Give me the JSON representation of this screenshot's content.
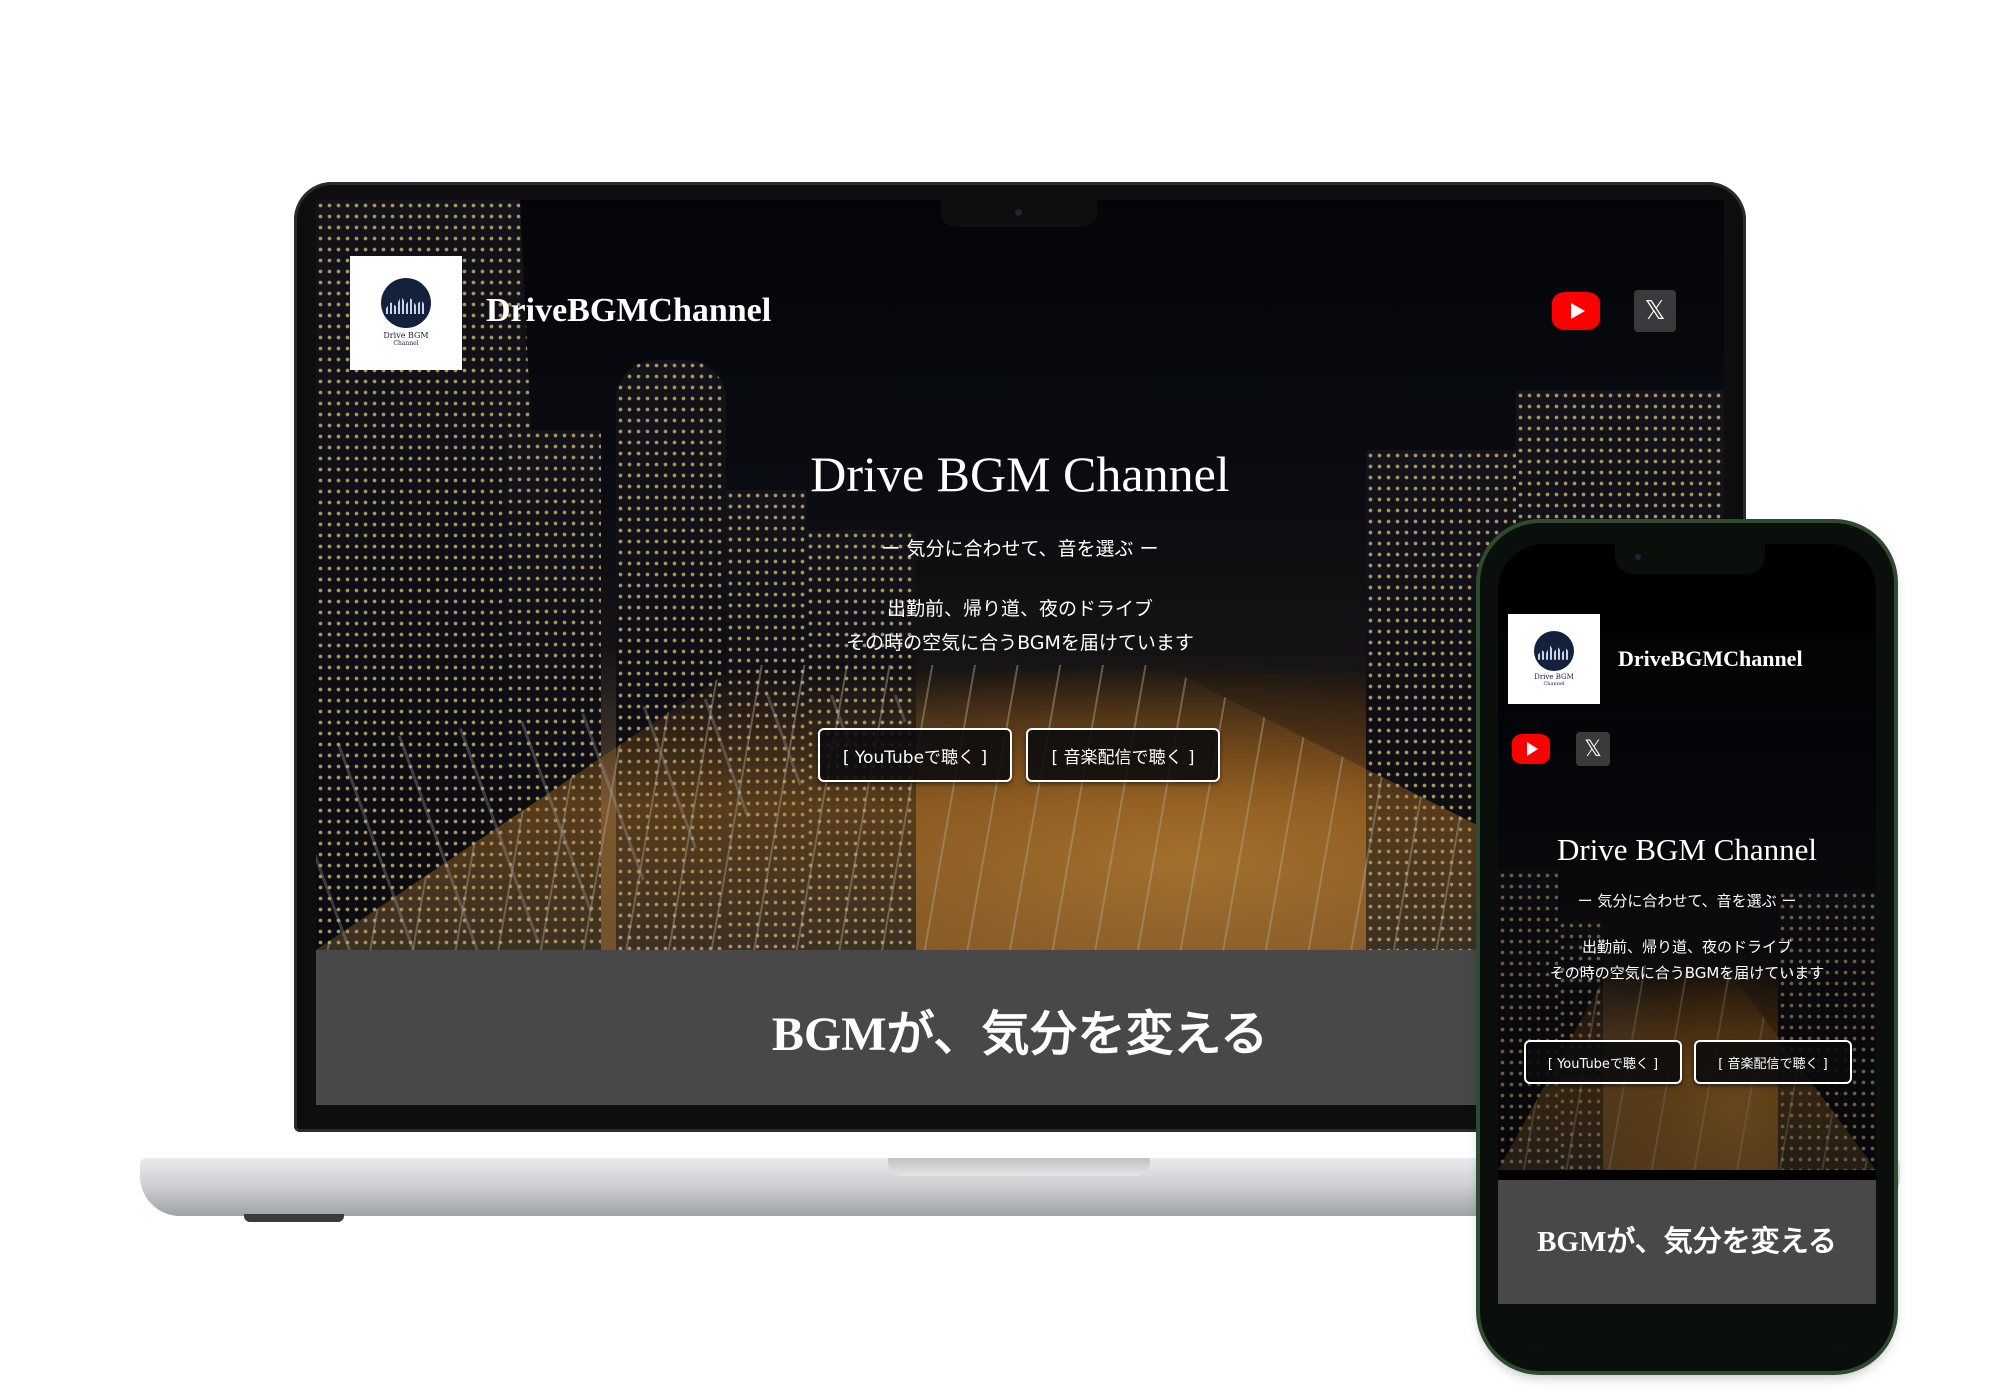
{
  "site": {
    "brand": "DriveBGMChannel",
    "logo_line1": "Drive BGM",
    "logo_line2": "Channel",
    "hero_title": "Drive BGM Channel",
    "hero_subtitle": "ー 気分に合わせて、音を選ぶ ー",
    "hero_desc_line1": "出勤前、帰り道、夜のドライブ",
    "hero_desc_line2": "その時の空気に合うBGMを届けています",
    "button_youtube": "[ YouTubeで聴く ]",
    "button_streaming": "[ 音楽配信で聴く ]",
    "section_heading": "BGMが、気分を変える",
    "x_icon_glyph": "𝕏"
  },
  "icons": {
    "youtube": "youtube-icon",
    "x": "x-icon"
  },
  "colors": {
    "youtube_red": "#ff0000",
    "band_gray": "#484848",
    "phone_frame_green": "#2f4a30"
  }
}
